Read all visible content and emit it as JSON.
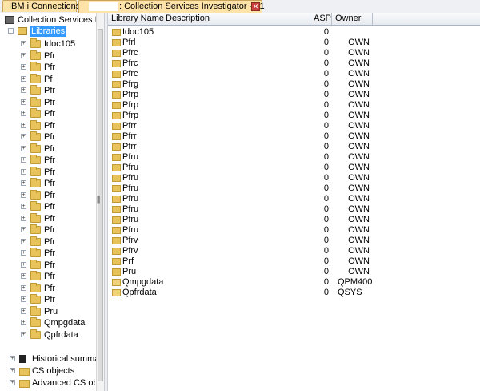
{
  "tabs": [
    {
      "label": "IBM i Connections"
    },
    {
      "label": ": Collection Services Investigator - #1"
    }
  ],
  "tree": {
    "root": "Collection Services Inv",
    "libraries_label": "Libraries",
    "library_nodes": [
      "Idoc105",
      "Pfr",
      "Pfr",
      "Pf",
      "Pfr",
      "Pfr",
      "Pfr",
      "Pfr",
      "Pfr",
      "Pfr",
      "Pfr",
      "Pfr",
      "Pfr",
      "Pfr",
      "Pfr",
      "Pfr",
      "Pfr",
      "Pfr",
      "Pfr",
      "Pfr",
      "Pfr",
      "Pfr",
      "Pfr",
      "Pru",
      "Qmpgdata",
      "Qpfrdata"
    ],
    "other_nodes": [
      "Historical summar",
      "CS objects",
      "Advanced CS obje"
    ]
  },
  "grid": {
    "columns": [
      "Library Name",
      "Description",
      "ASP",
      "Owner"
    ],
    "rows": [
      {
        "name": "Idoc105",
        "asp": "0",
        "owner": ""
      },
      {
        "name": "Pfrl",
        "asp": "0",
        "owner": "OWN"
      },
      {
        "name": "Pfrc",
        "asp": "0",
        "owner": "OWN"
      },
      {
        "name": "Pfrc",
        "asp": "0",
        "owner": "OWN"
      },
      {
        "name": "Pfrc",
        "asp": "0",
        "owner": "OWN"
      },
      {
        "name": "Pfrg",
        "asp": "0",
        "owner": "OWN"
      },
      {
        "name": "Pfrp",
        "asp": "0",
        "owner": "OWN"
      },
      {
        "name": "Pfrp",
        "asp": "0",
        "owner": "OWN"
      },
      {
        "name": "Pfrp",
        "asp": "0",
        "owner": "OWN"
      },
      {
        "name": "Pfrr",
        "asp": "0",
        "owner": "OWN"
      },
      {
        "name": "Pfrr",
        "asp": "0",
        "owner": "OWN"
      },
      {
        "name": "Pfrr",
        "asp": "0",
        "owner": "OWN"
      },
      {
        "name": "Pfru",
        "asp": "0",
        "owner": "OWN"
      },
      {
        "name": "Pfru",
        "asp": "0",
        "owner": "OWN"
      },
      {
        "name": "Pfru",
        "asp": "0",
        "owner": "OWN"
      },
      {
        "name": "Pfru",
        "asp": "0",
        "owner": "OWN"
      },
      {
        "name": "Pfru",
        "asp": "0",
        "owner": "OWN"
      },
      {
        "name": "Pfru",
        "asp": "0",
        "owner": "OWN"
      },
      {
        "name": "Pfru",
        "asp": "0",
        "owner": "OWN"
      },
      {
        "name": "Pfru",
        "asp": "0",
        "owner": "OWN"
      },
      {
        "name": "Pfrv",
        "asp": "0",
        "owner": "OWN"
      },
      {
        "name": "Pfrv",
        "asp": "0",
        "owner": "OWN"
      },
      {
        "name": "Prf",
        "asp": "0",
        "owner": "OWN"
      },
      {
        "name": "Pru",
        "asp": "0",
        "owner": "OWN"
      },
      {
        "name": "Qmpgdata",
        "asp": "0",
        "owner": "QPM400"
      },
      {
        "name": "Qpfrdata",
        "asp": "0",
        "owner": "QSYS"
      }
    ]
  }
}
